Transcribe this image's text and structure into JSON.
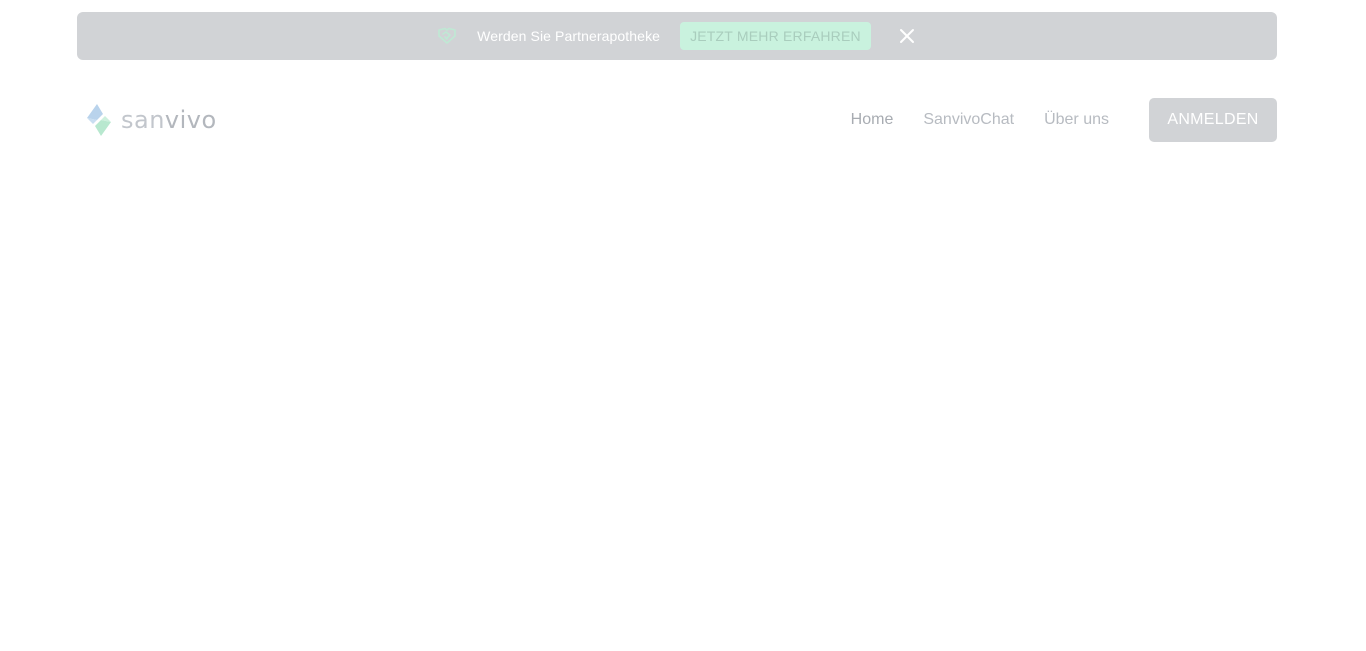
{
  "banner": {
    "icon": "handshake-icon",
    "text": "Werden Sie Partnerapotheke",
    "cta_label": "JETZT MEHR ERFAHREN",
    "close_icon": "close-icon"
  },
  "header": {
    "logo": {
      "icon": "sanvivo-logo-mark",
      "text_light": "san",
      "text_bold": "vivo"
    },
    "nav": [
      {
        "label": "Home"
      },
      {
        "label": "SanvivoChat"
      },
      {
        "label": "Über uns"
      }
    ],
    "login_label": "ANMELDEN"
  },
  "colors": {
    "overlay_gray": "#d1d3d6",
    "cta_mint": "#c9f2de",
    "nav_text": "#b7bbc1",
    "logo_blue": "#b9d3ec",
    "logo_green": "#b8e8cf"
  }
}
